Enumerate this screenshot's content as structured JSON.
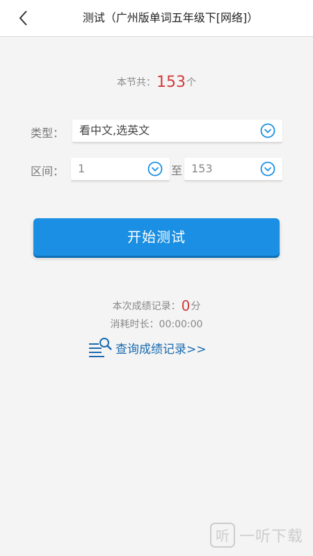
{
  "header": {
    "title": "测试（广州版单词五年级下[网络]）",
    "back_icon": "chevron-left-icon"
  },
  "summary": {
    "prefix": "本节共：",
    "count": "153",
    "suffix": "个"
  },
  "type_row": {
    "label": "类型：",
    "selected": "看中文,选英文"
  },
  "range_row": {
    "label": "区间：",
    "start": "1",
    "to_label": "至",
    "end": "153"
  },
  "start_button": {
    "label": "开始测试"
  },
  "score": {
    "prefix": "本次成绩记录：",
    "value": "0",
    "suffix": "分"
  },
  "elapsed": {
    "label": "消耗时长：",
    "value": "00:00:00"
  },
  "history_link": {
    "label": "查询成绩记录>>",
    "icon": "search-list-icon"
  },
  "watermark": {
    "text": "一听下载"
  },
  "colors": {
    "accent": "#1a8fe3",
    "highlight": "#d23a3a",
    "link": "#1a6ab0"
  }
}
